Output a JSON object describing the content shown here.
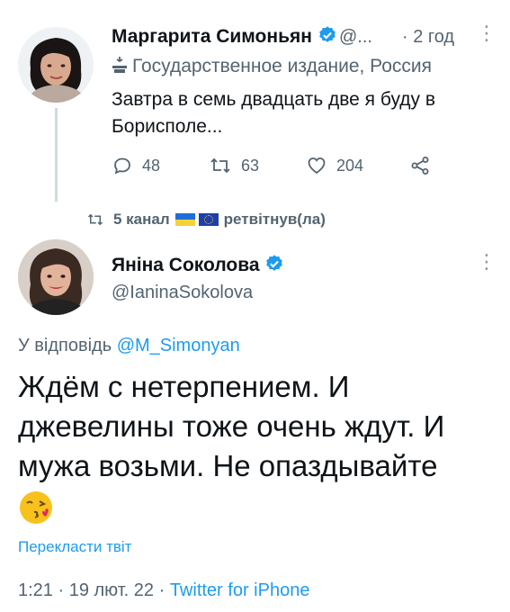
{
  "quoted_tweet": {
    "author_name": "Маргарита Симоньян",
    "handle": "@...",
    "time": "· 2 год",
    "more": "⋮",
    "label": "Государственное издание, Россия",
    "text": "Завтра в семь двадцать две я буду в Борисполе...",
    "stats": {
      "replies": "48",
      "retweets": "63",
      "likes": "204"
    }
  },
  "retweet_bar": {
    "text_before": "5 канал",
    "text_after": "ретвітнув(ла)"
  },
  "tweet": {
    "author_name": "Яніна Соколова",
    "handle": "@IaninaSokolova",
    "more": "⋮",
    "reply_prefix": "У відповідь",
    "reply_to": "@M_Simonyan",
    "text": "Ждём с нетерпением. И джевелины тоже очень ждут. И мужа возьми. Не опаздывайте",
    "translate_label": "Перекласти твіт",
    "timestamp": "1:21 · 19 лют. 22 · ",
    "source": "Twitter for iPhone"
  },
  "colors": {
    "accent": "#1d9bf0",
    "muted": "#536471",
    "text": "#0f1419"
  }
}
